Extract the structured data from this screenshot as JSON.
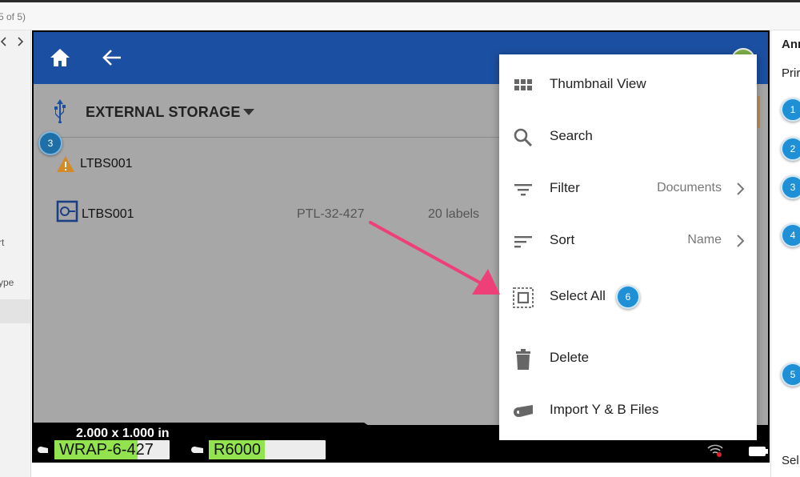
{
  "page_indicator": "5 of 5)",
  "left_panel": {
    "items": [
      "rt",
      "ype"
    ]
  },
  "device": {
    "storage_label": "EXTERNAL STORAGE",
    "rows": [
      {
        "name": "LTBS001"
      },
      {
        "name": "LTBS001",
        "part": "PTL-32-427",
        "count": "20 labels"
      }
    ],
    "status": {
      "dims": "2.000 x 1.000 in",
      "label_chip": "WRAP-6-427",
      "label_chip_fill": 0.72,
      "ribbon_chip": "R6000",
      "ribbon_chip_fill": 0.48
    }
  },
  "menu": {
    "items": [
      {
        "icon": "grid-icon",
        "label": "Thumbnail View"
      },
      {
        "icon": "search-icon",
        "label": "Search"
      },
      {
        "icon": "filter-icon",
        "label": "Filter",
        "value": "Documents"
      },
      {
        "icon": "sort-icon",
        "label": "Sort",
        "value": "Name"
      },
      {
        "icon": "select-all-icon",
        "label": "Select All"
      },
      {
        "icon": "trash-icon",
        "label": "Delete"
      },
      {
        "icon": "tape-roll-icon",
        "label": "Import Y & B Files"
      }
    ]
  },
  "callouts": {
    "c3_left": "3",
    "c6": "6",
    "right": [
      "1",
      "2",
      "3",
      "4",
      "5"
    ]
  },
  "right_panel": {
    "heading": "Anı",
    "sub": "Prir",
    "bottom": "Sel"
  },
  "colors": {
    "appbar": "#1b4fa1",
    "highlight_green": "#93e34f",
    "callout_blue": "#1f8fd6",
    "arrow_pink": "#ee3f78",
    "warning_orange": "#d58a2a"
  }
}
